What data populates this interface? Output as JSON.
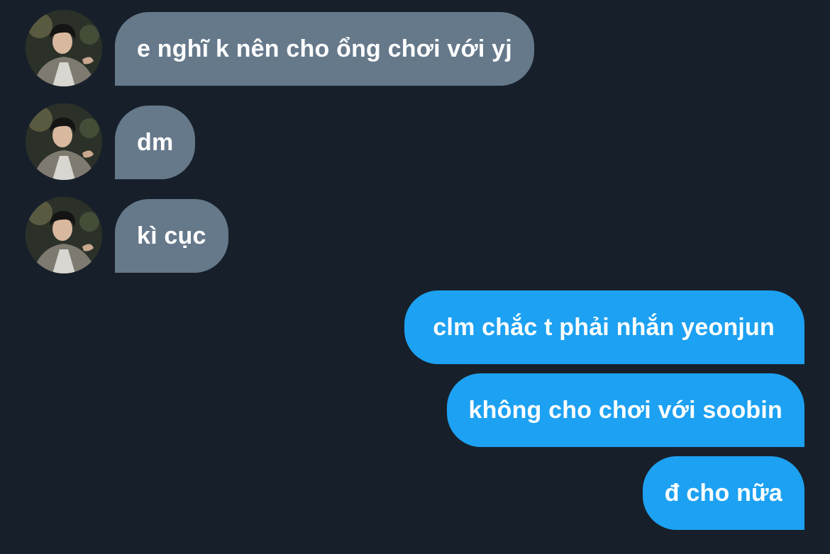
{
  "conversation": {
    "incoming": [
      {
        "text": "e nghĩ k nên cho ổng chơi với yj"
      },
      {
        "text": "dm"
      },
      {
        "text": "kì cục"
      }
    ],
    "outgoing": [
      {
        "text": "clm chắc t phải nhắn yeonjun"
      },
      {
        "text": "không cho chơi với soobin"
      },
      {
        "text": "đ cho nữa"
      }
    ]
  },
  "colors": {
    "background": "#17202a",
    "incoming_bubble": "#66798b",
    "outgoing_bubble": "#1da1f2",
    "text": "#ffffff"
  },
  "icons": {
    "avatar": "profile-photo"
  }
}
